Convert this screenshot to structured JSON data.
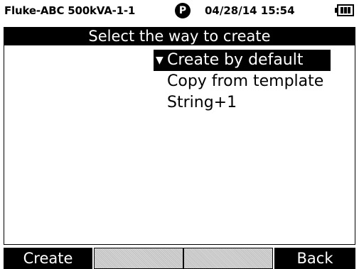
{
  "status": {
    "device": "Fluke-ABC 500kVA-1-1",
    "p_badge": "P",
    "datetime": "04/28/14 15:54",
    "battery_icon": "battery-icon"
  },
  "title": "Select the way to create",
  "menu": {
    "items": [
      {
        "label": "Create by default",
        "selected": true
      },
      {
        "label": "Copy from template",
        "selected": false
      },
      {
        "label": "String+1",
        "selected": false
      }
    ]
  },
  "fkeys": {
    "f1": "Create",
    "f2": "",
    "f3": "",
    "f4": "Back"
  },
  "colors": {
    "foreground": "#000000",
    "background": "#ffffff",
    "disabled_key": "#c8c8c8"
  }
}
